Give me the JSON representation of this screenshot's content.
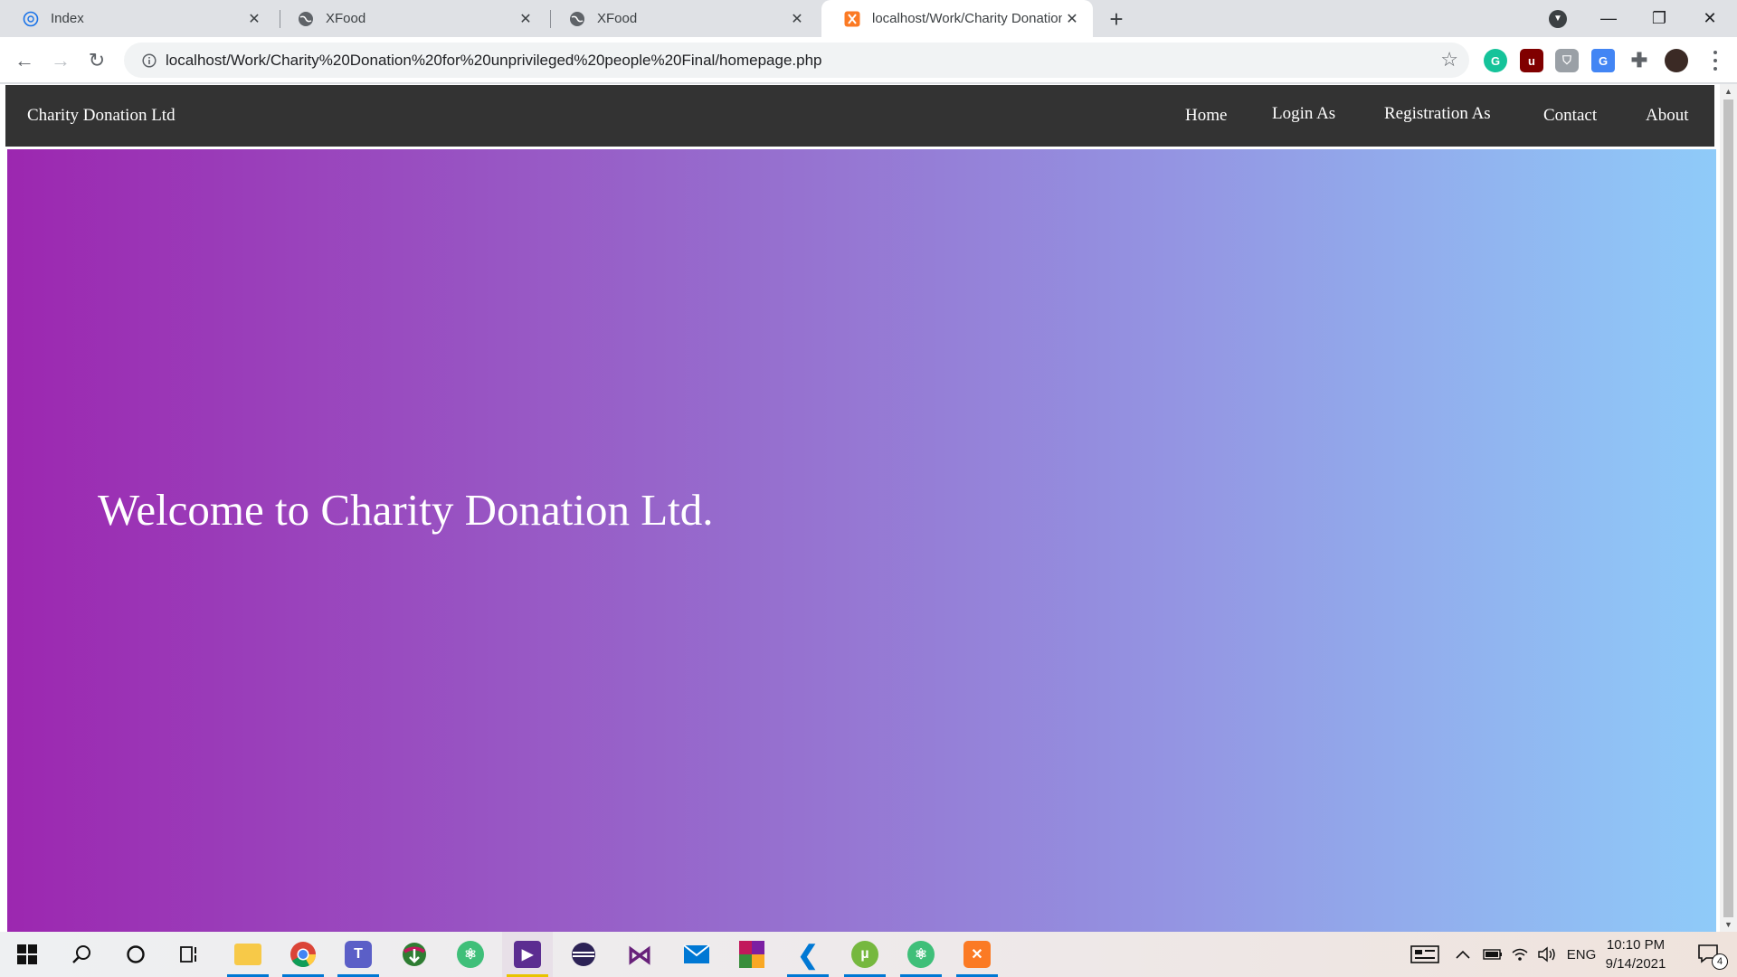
{
  "browser": {
    "tabs": [
      {
        "title": "Index",
        "icon": "globe-outline-icon",
        "active": false
      },
      {
        "title": "XFood",
        "icon": "globe-icon",
        "active": false
      },
      {
        "title": "XFood",
        "icon": "globe-icon",
        "active": false
      },
      {
        "title": "localhost/Work/Charity Donation",
        "icon": "xampp-icon",
        "active": true
      }
    ],
    "new_tab_label": "+",
    "address_bar": {
      "url": "localhost/Work/Charity%20Donation%20for%20unprivileged%20people%20Final/homepage.php"
    },
    "extensions": [
      "grammarly-icon",
      "ublock-icon",
      "shield-extension-icon",
      "translate-icon",
      "puzzle-icon",
      "profile-avatar-icon"
    ]
  },
  "site": {
    "brand": "Charity Donation Ltd",
    "nav": {
      "home": "Home",
      "login": "Login As",
      "registration": "Registration As",
      "contact": "Contact",
      "about": "About"
    },
    "hero_title": "Welcome to Charity Donation Ltd.",
    "gradient_colors": [
      "#9c27b0",
      "#8fcbf9"
    ]
  },
  "taskbar": {
    "apps": [
      "windows-start-icon",
      "search-icon",
      "cortana-icon",
      "task-view-icon",
      "file-explorer-icon",
      "chrome-icon",
      "teams-icon",
      "internet-download-manager-icon",
      "atom-icon",
      "visual-studio-purple-icon",
      "eclipse-icon",
      "visual-studio-icon",
      "mail-icon",
      "winrar-icon",
      "vscode-icon",
      "utorrent-icon",
      "atom-icon-2",
      "xampp-icon"
    ],
    "tray": {
      "language": "ENG",
      "time": "10:10 PM",
      "date": "9/14/2021",
      "notification_count": "4"
    }
  }
}
